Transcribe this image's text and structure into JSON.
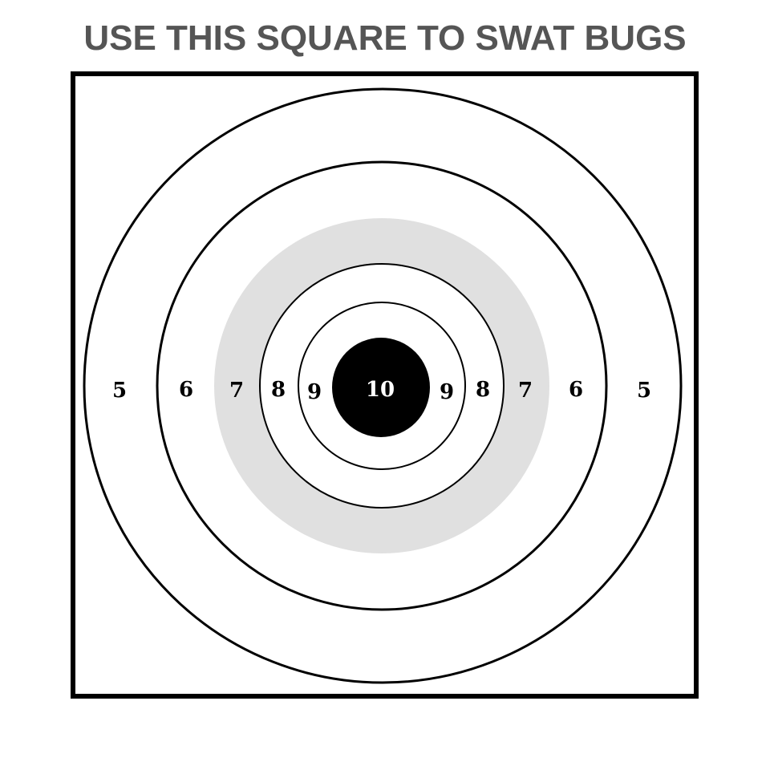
{
  "heading": "USE THIS SQUARE TO SWAT BUGS",
  "colors": {
    "heading": "#555555",
    "ring_stroke": "#000000",
    "gray_band": "#e0e0e0",
    "bullseye": "#000000",
    "bullseye_text": "#ffffff",
    "background": "#ffffff"
  },
  "target": {
    "bullseye_label": "10",
    "left_scores": [
      "5",
      "6",
      "7",
      "8",
      "9"
    ],
    "right_scores": [
      "9",
      "8",
      "7",
      "6",
      "5"
    ]
  }
}
